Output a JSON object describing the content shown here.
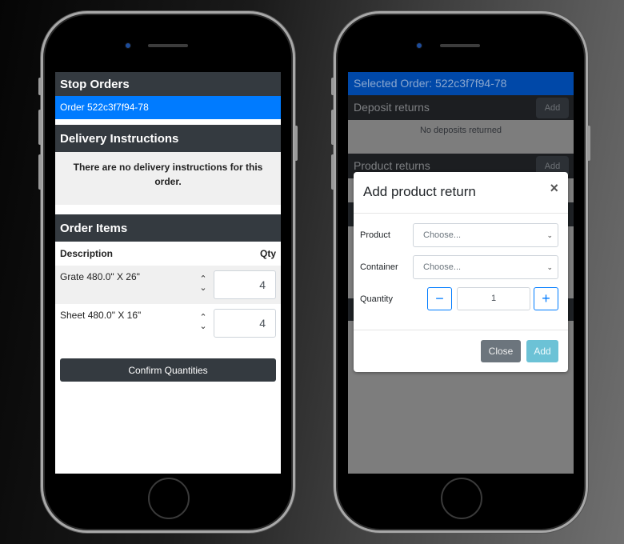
{
  "left_phone": {
    "stop_orders": {
      "header": "Stop Orders",
      "orders": [
        {
          "label": "Order 522c3f7f94-78",
          "selected": true
        }
      ]
    },
    "delivery_instructions": {
      "header": "Delivery Instructions",
      "message": "There are no delivery instructions for this order."
    },
    "order_items": {
      "header": "Order Items",
      "columns": [
        "Description",
        "Qty"
      ],
      "rows": [
        {
          "description": "Grate 480.0\" X 26\"",
          "qty": "4"
        },
        {
          "description": "Sheet 480.0\" X 16\"",
          "qty": "4"
        }
      ],
      "confirm_label": "Confirm Quantities"
    }
  },
  "right_phone": {
    "selected_order": "Selected Order: 522c3f7f94-78",
    "deposit_returns": {
      "header": "Deposit returns",
      "add_label": "Add",
      "empty_message": "No deposits returned"
    },
    "product_returns": {
      "header": "Product returns",
      "add_label": "Add"
    },
    "modal": {
      "title": "Add product return",
      "close_icon": "×",
      "product_label": "Product",
      "product_placeholder": "Choose...",
      "container_label": "Container",
      "container_placeholder": "Choose...",
      "quantity_label": "Quantity",
      "quantity_value": "1",
      "minus_label": "−",
      "plus_label": "+",
      "close_button": "Close",
      "add_button": "Add"
    }
  },
  "icons": {
    "stepper": "up-down-chevron",
    "select_caret": "⌄"
  },
  "colors": {
    "primary": "#007bff",
    "dark": "#343a40",
    "secondary": "#6c757d",
    "info": "#17a2b8"
  }
}
